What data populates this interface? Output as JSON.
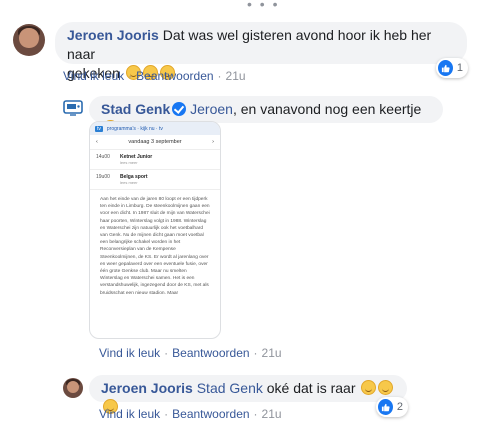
{
  "comments": [
    {
      "author": "Jeroen Jooris",
      "text_line1": "Dat was wel gisteren avond hoor ik heb her naar",
      "text_line2": "gekeken",
      "actions": {
        "like": "Vind ik leuk",
        "reply": "Beantwoorden",
        "time": "21u"
      },
      "reaction_count": "1"
    },
    {
      "author": "Stad Genk",
      "mention": "Jeroen",
      "text": ", en vanavond nog een keertje",
      "actions": {
        "like": "Vind ik leuk",
        "reply": "Beantwoorden",
        "time": "21u"
      },
      "attachment": {
        "nav_left": "vandaag 3 september",
        "programs": [
          {
            "time": "14u00",
            "title": "Ketnet Junior",
            "sub": "lees meer"
          },
          {
            "time": "19u00",
            "title": "Belga sport",
            "sub": "lees meer"
          }
        ],
        "body": "Aan het einde van de jaren 80 loopt er een tijdperk ten einde in Limburg. De steenkoolmijnen gaan een voor een dicht. In 1987 sluit de mijn van Waterschei haar poorten, Winterslag volgt in 1988. Winterslag en Waterschei zijn natuurlijk ook het voetbalhard van Genk. Nu de mijnen dicht gaan moet voetbal een belangrijke schakel worden in het Reconversieplan van de Kempense Steenkoolmijnen, de KS. Er wordt al jarenlang over en weer gepalaverd over een eventuele fusie, over één grote Genkse club. Maar nu smelten Winterslag en Waterschei samen. Het is een verstandshuwelijk, ingezegend door de KS, met als bruidsschat een nieuw stadion. Maar"
      }
    },
    {
      "author": "Jeroen Jooris",
      "mention": "Stad Genk",
      "text": "oké dat is raar",
      "actions": {
        "like": "Vind ik leuk",
        "reply": "Beantwoorden",
        "time": "21u"
      },
      "reaction_count": "2"
    }
  ],
  "colors": {
    "link": "#385898",
    "bubble": "#f2f3f5",
    "meta": "#90949c",
    "like_blue": "#1877f2"
  },
  "icons": [
    "more-dots-icon",
    "smile-emoji-icon",
    "wink-emoji-icon",
    "like-reaction-icon",
    "verified-badge-icon",
    "tv-logo-icon"
  ]
}
